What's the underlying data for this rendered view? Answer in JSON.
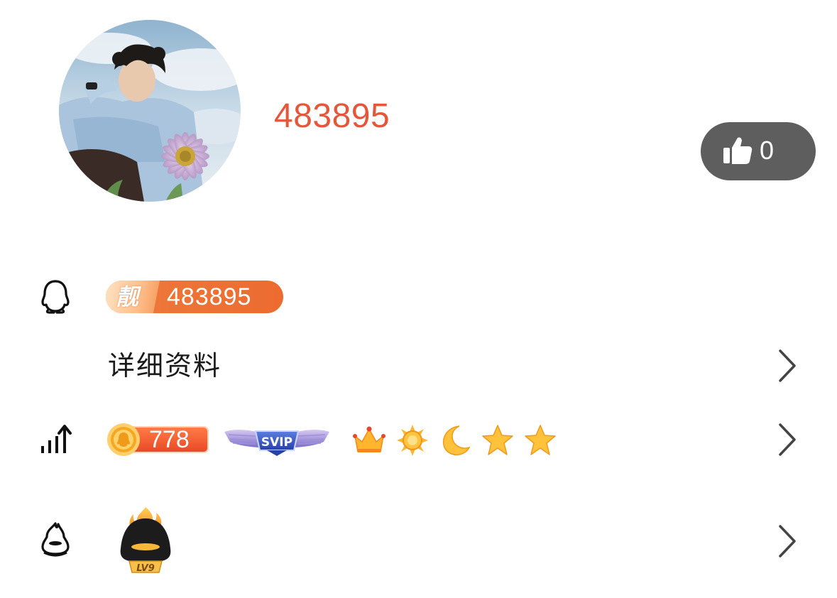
{
  "profile": {
    "nickname": "483895",
    "like_count": "0",
    "pretty_number_tag": "靓",
    "pretty_number": "483895",
    "detail_label": "详细资料",
    "level_points": "778",
    "svip_label": "SVIP",
    "lv_badge_label": "LV9"
  },
  "icons": {
    "avatar": "avatar-photo",
    "like": "thumbs-up-icon",
    "qq_row": "penguin-icon",
    "level_row": "signal-up-icon",
    "fire_row": "fire-penguin-icon",
    "level_icons": [
      "crown-icon",
      "sun-icon",
      "moon-icon",
      "star-icon",
      "star-icon"
    ]
  },
  "colors": {
    "nickname": "#e4573a",
    "like_button_bg": "#5e5e5e",
    "pretty_badge": "#ec6b30",
    "coin_pill": "#e94a27"
  }
}
